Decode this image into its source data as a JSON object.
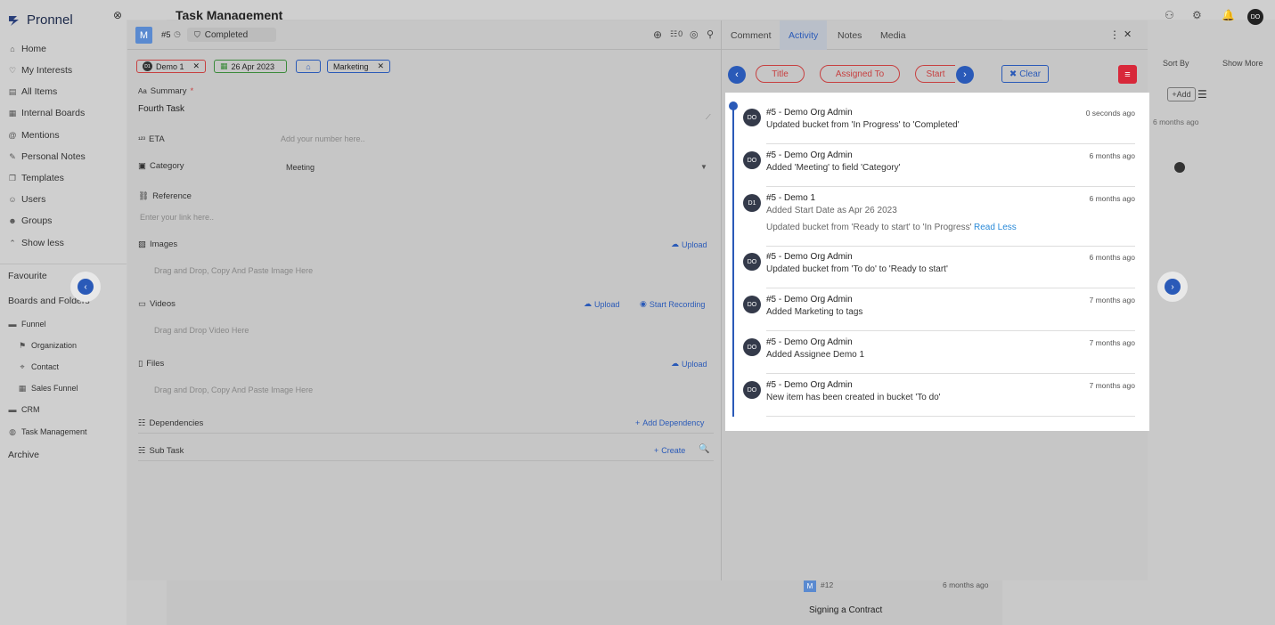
{
  "app": {
    "name": "Pronnel",
    "page_title": "Task Management",
    "user_initials": "DO"
  },
  "sidebar": {
    "items": [
      {
        "label": "Home",
        "icon": "home-icon"
      },
      {
        "label": "My Interests",
        "icon": "interests-icon"
      },
      {
        "label": "All Items",
        "icon": "items-icon"
      },
      {
        "label": "Internal Boards",
        "icon": "boards-icon"
      },
      {
        "label": "Mentions",
        "icon": "at-icon"
      },
      {
        "label": "Personal Notes",
        "icon": "notes-icon"
      },
      {
        "label": "Templates",
        "icon": "templates-icon"
      },
      {
        "label": "Users",
        "icon": "user-icon"
      },
      {
        "label": "Groups",
        "icon": "groups-icon"
      },
      {
        "label": "Show less",
        "icon": "chevron-up-icon"
      }
    ],
    "favourite": "Favourite",
    "boards_and_folders": "Boards and Folders",
    "folders": [
      {
        "label": "Funnel",
        "icon": "folder-icon"
      },
      {
        "label": "Organization",
        "icon": "flag-icon"
      },
      {
        "label": "Contact",
        "icon": "pin-icon"
      },
      {
        "label": "Sales Funnel",
        "icon": "board-icon"
      },
      {
        "label": "CRM",
        "icon": "folder-icon"
      },
      {
        "label": "Task Management",
        "icon": "globe-icon"
      }
    ],
    "archive": "Archive"
  },
  "background": {
    "sort_by": "Sort By",
    "show_more": "Show More",
    "add": "+Add",
    "bg_time": "6 months ago",
    "card_id": "#12",
    "card_time": "6 months ago",
    "card_title": "Signing a Contract"
  },
  "task": {
    "avatar_letter": "M",
    "id": "#5",
    "status": "Completed",
    "count": "0",
    "tags": {
      "assignee": "Demo 1",
      "assignee_initials": "D1",
      "date": "26 Apr 2023",
      "tag": "Marketing"
    },
    "summary_label": "Summary",
    "summary_value": "Fourth Task",
    "eta_label": "ETA",
    "eta_placeholder": "Add your number here..",
    "category_label": "Category",
    "category_value": "Meeting",
    "reference_label": "Reference",
    "reference_placeholder": "Enter your link here..",
    "images_label": "Images",
    "images_upload": "Upload",
    "images_drop": "Drag and Drop, Copy And Paste Image Here",
    "videos_label": "Videos",
    "videos_upload": "Upload",
    "videos_record": "Start Recording",
    "videos_drop": "Drag and Drop Video Here",
    "files_label": "Files",
    "files_upload": "Upload",
    "files_drop": "Drag and Drop, Copy And Paste Image Here",
    "dependencies_label": "Dependencies",
    "add_dependency": "Add Dependency",
    "subtask_label": "Sub Task",
    "create": "Create"
  },
  "right_tabs": [
    "Comment",
    "Activity",
    "Notes",
    "Media"
  ],
  "filters": {
    "title": "Title",
    "assigned_to": "Assigned To",
    "start": "Start",
    "clear": "Clear"
  },
  "activity": [
    {
      "avatar": "DO",
      "name": "#5 - Demo Org Admin",
      "lines": [
        "Updated bucket from 'In Progress' to 'Completed'"
      ],
      "time": "0 seconds ago"
    },
    {
      "avatar": "DO",
      "name": "#5 - Demo Org Admin",
      "lines": [
        "Added 'Meeting' to field 'Category'"
      ],
      "time": "6 months ago"
    },
    {
      "avatar": "D1",
      "name": "#5 - Demo 1",
      "lines": [
        "Added Start Date as Apr 26 2023",
        "Updated bucket from 'Ready to start' to 'In Progress'"
      ],
      "read_less": "Read Less",
      "time": "6 months ago"
    },
    {
      "avatar": "DO",
      "name": "#5 - Demo Org Admin",
      "lines": [
        "Updated bucket from 'To do' to 'Ready to start'"
      ],
      "time": "6 months ago"
    },
    {
      "avatar": "DO",
      "name": "#5 - Demo Org Admin",
      "lines": [
        "Added Marketing to tags"
      ],
      "time": "7 months ago"
    },
    {
      "avatar": "DO",
      "name": "#5 - Demo Org Admin",
      "lines": [
        "Added Assignee Demo 1"
      ],
      "time": "7 months ago"
    },
    {
      "avatar": "DO",
      "name": "#5 - Demo Org Admin",
      "lines": [
        "New item has been created in bucket 'To do'"
      ],
      "time": "7 months ago"
    }
  ],
  "colors": {
    "accent": "#2a5ab8",
    "red": "#c74040",
    "green": "#3a8a3a"
  }
}
